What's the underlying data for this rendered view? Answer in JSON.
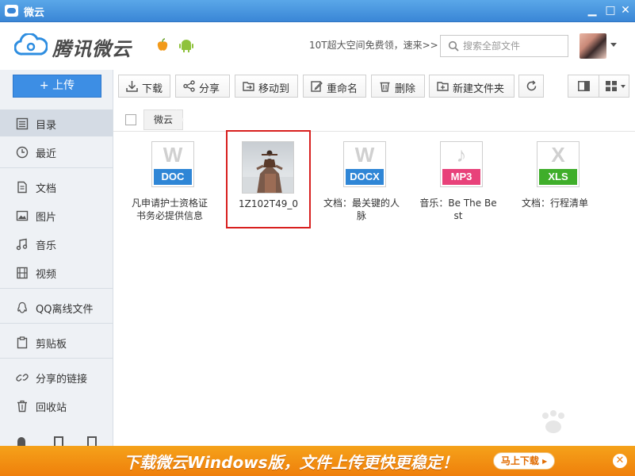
{
  "window": {
    "title": "微云",
    "minimize_glyph": "▁",
    "maximize_glyph": "□",
    "close_glyph": "✕"
  },
  "header": {
    "logo_text": "腾讯微云",
    "promo_link": "10T超大空间免费领，速来>>",
    "search_placeholder": "搜索全部文件"
  },
  "sidebar": {
    "upload_label": "+ 上传",
    "items": [
      {
        "label": "目录",
        "icon": "list-icon",
        "active": true
      },
      {
        "label": "最近",
        "icon": "clock-icon"
      },
      {
        "label": "文档",
        "icon": "document-icon"
      },
      {
        "label": "图片",
        "icon": "image-icon"
      },
      {
        "label": "音乐",
        "icon": "music-icon"
      },
      {
        "label": "视频",
        "icon": "film-icon"
      },
      {
        "label": "QQ离线文件",
        "icon": "qq-icon"
      },
      {
        "label": "剪贴板",
        "icon": "clipboard-icon"
      },
      {
        "label": "分享的链接",
        "icon": "link-icon"
      },
      {
        "label": "回收站",
        "icon": "trash-icon"
      }
    ]
  },
  "toolbar": {
    "download": "下载",
    "share": "分享",
    "move": "移动到",
    "rename": "重命名",
    "delete": "删除",
    "new_folder": "新建文件夹"
  },
  "breadcrumb": {
    "root": "微云"
  },
  "files": [
    {
      "name": "凡申请护士资格证书务必提供信息",
      "type": "DOC",
      "glyph": "W",
      "band_color": "#2f86d6"
    },
    {
      "name": "1Z102T49_0",
      "type": "image",
      "selected": true
    },
    {
      "name": "文档：最关键的人脉",
      "type": "DOCX",
      "glyph": "W",
      "band_color": "#2f86d6"
    },
    {
      "name": "音乐：Be The Best",
      "type": "MP3",
      "glyph": "♪",
      "band_color": "#e8427a"
    },
    {
      "name": "文档：行程清单",
      "type": "XLS",
      "glyph": "X",
      "band_color": "#3fae2a"
    }
  ],
  "banner": {
    "text": "下载微云Windows版，文件上传更快更稳定！",
    "button": "马上下载 ▸",
    "close_glyph": "✕"
  },
  "colors": {
    "accent": "#3d8ee4",
    "banner": "#f39214",
    "selection": "#d8201f"
  }
}
